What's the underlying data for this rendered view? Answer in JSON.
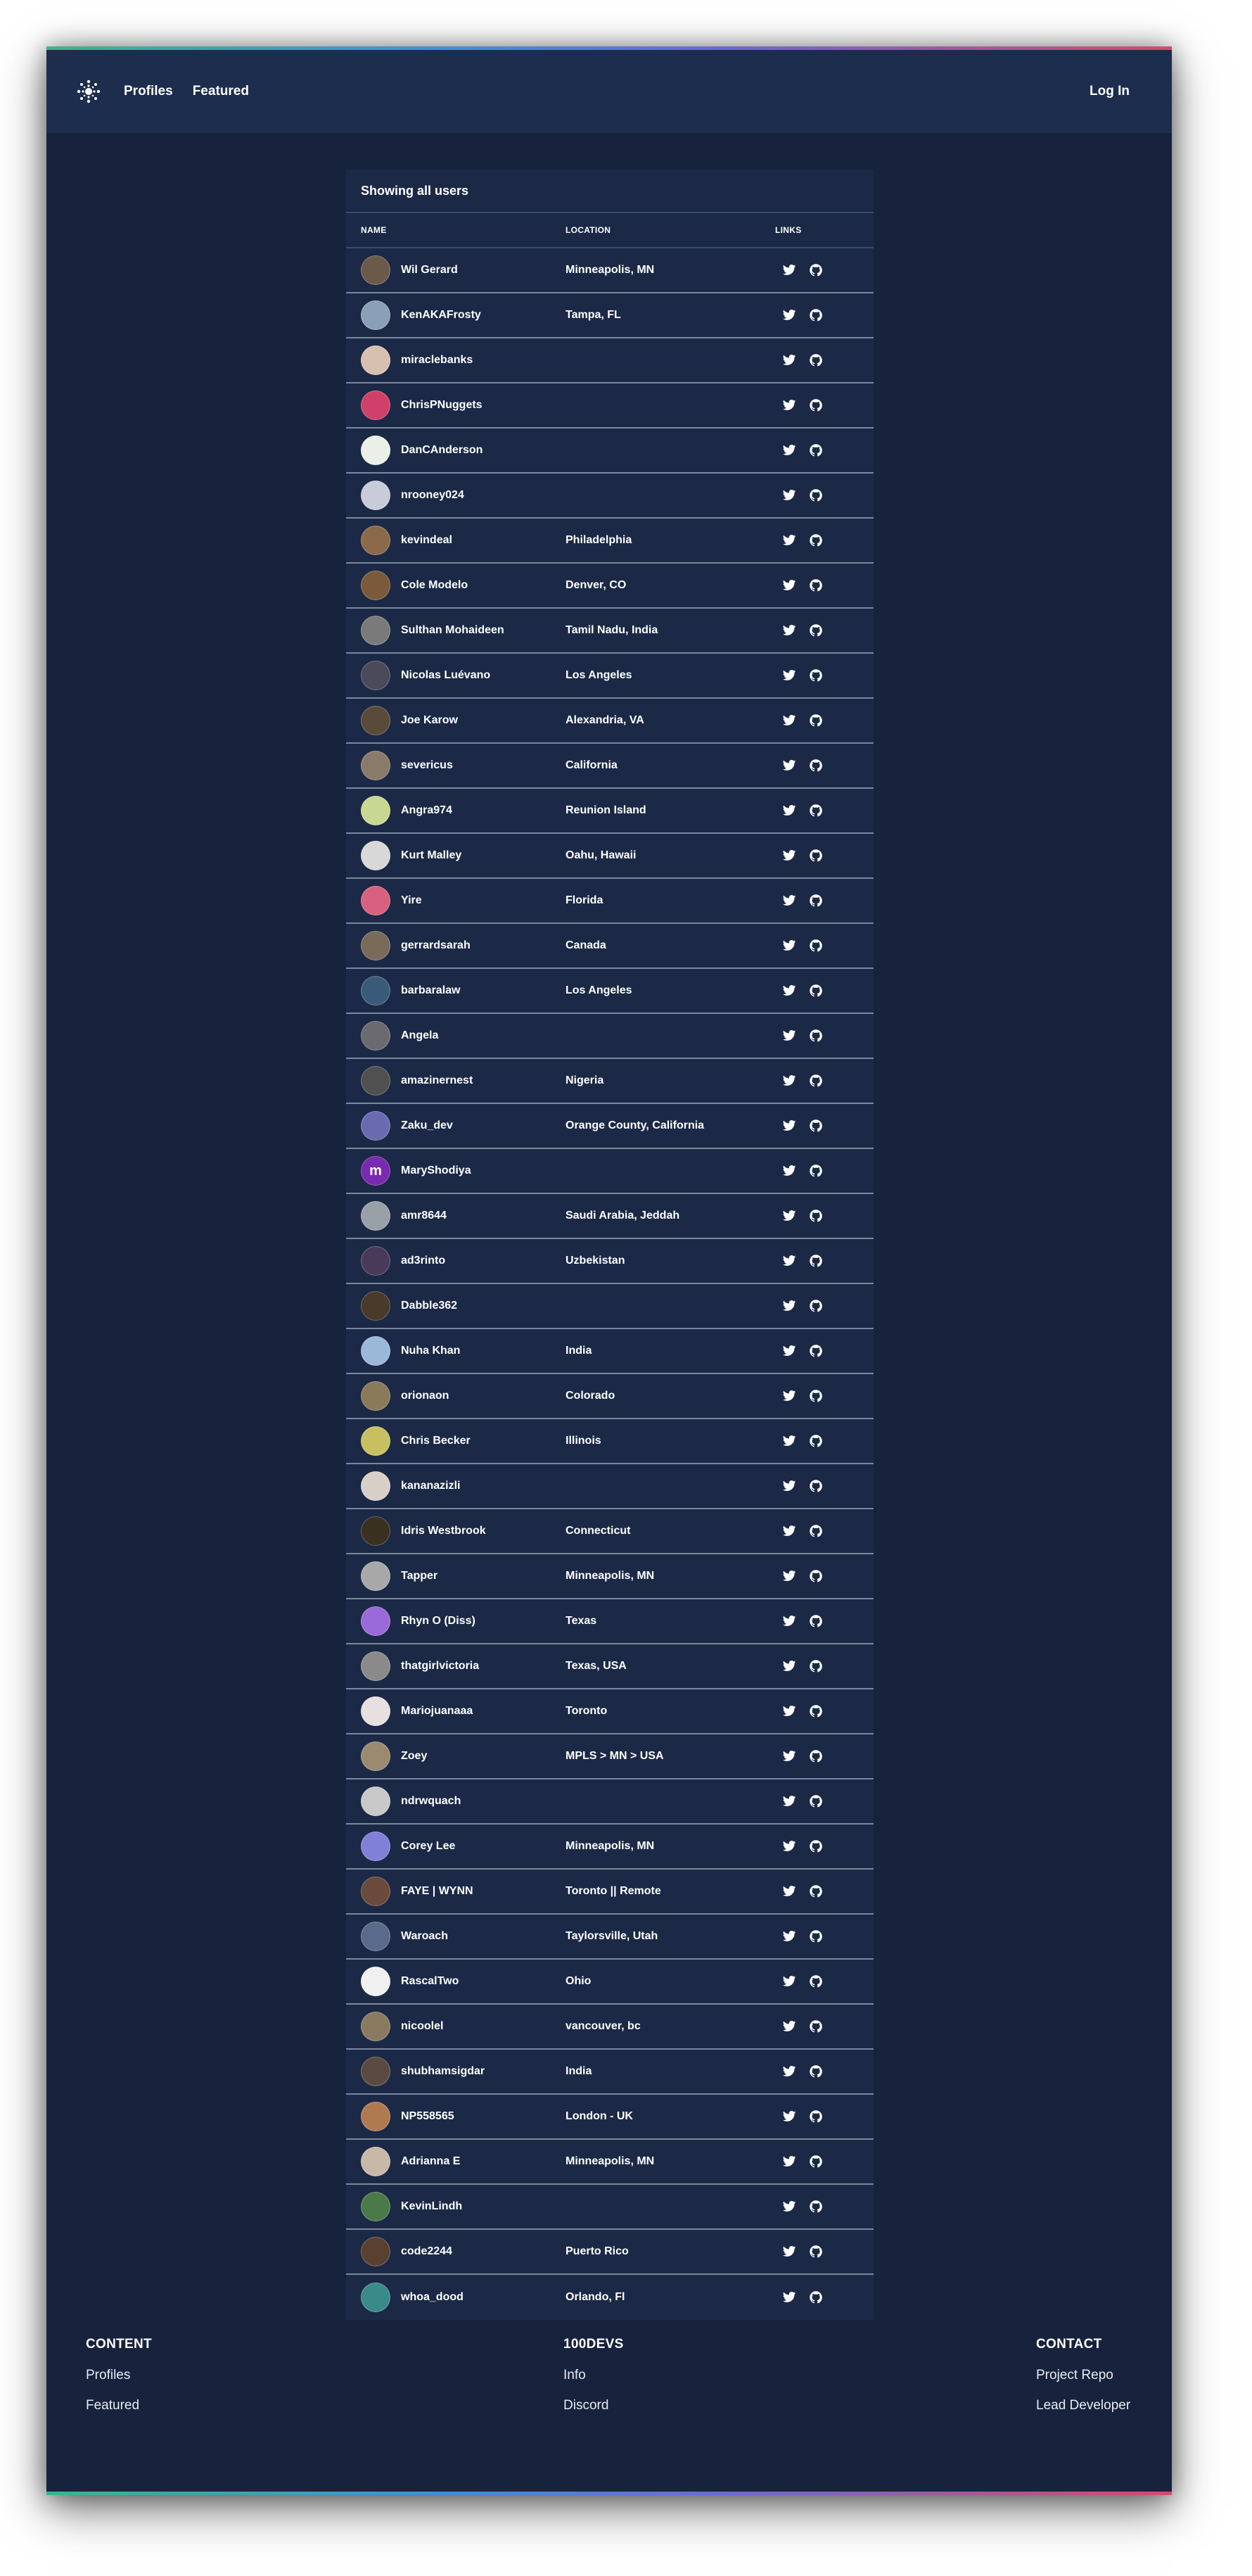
{
  "nav": {
    "logo_icon": "burst-logo-icon",
    "links": [
      "Profiles",
      "Featured"
    ],
    "login": "Log In"
  },
  "table": {
    "title": "Showing all users",
    "headers": {
      "name": "NAME",
      "location": "LOCATION",
      "links": "LINKS"
    },
    "rows": [
      {
        "name": "Wil Gerard",
        "location": "Minneapolis, MN",
        "avatar_color": "#6b5a4a"
      },
      {
        "name": "KenAKAFrosty",
        "location": "Tampa, FL",
        "avatar_color": "#8aa0b8"
      },
      {
        "name": "miraclebanks",
        "location": "",
        "avatar_color": "#d8c0b0"
      },
      {
        "name": "ChrisPNuggets",
        "location": "",
        "avatar_color": "#d0406a"
      },
      {
        "name": "DanCAnderson",
        "location": "",
        "avatar_color": "#e8f0e8"
      },
      {
        "name": "nrooney024",
        "location": "",
        "avatar_color": "#c8ccd8"
      },
      {
        "name": "kevindeal",
        "location": "Philadelphia",
        "avatar_color": "#8a6a4a"
      },
      {
        "name": "Cole Modelo",
        "location": "Denver, CO",
        "avatar_color": "#7a5a3a"
      },
      {
        "name": "Sulthan Mohaideen",
        "location": "Tamil Nadu, India",
        "avatar_color": "#7a7a7a"
      },
      {
        "name": "Nicolas Luévano",
        "location": "Los Angeles",
        "avatar_color": "#4a4a5a"
      },
      {
        "name": "Joe Karow",
        "location": "Alexandria, VA",
        "avatar_color": "#5a4a3a"
      },
      {
        "name": "severicus",
        "location": "California",
        "avatar_color": "#8a7a6a"
      },
      {
        "name": "Angra974",
        "location": "Reunion Island",
        "avatar_color": "#c8d890"
      },
      {
        "name": "Kurt Malley",
        "location": "Oahu, Hawaii",
        "avatar_color": "#d8d8d8"
      },
      {
        "name": "Yire",
        "location": "Florida",
        "avatar_color": "#d86080"
      },
      {
        "name": "gerrardsarah",
        "location": "Canada",
        "avatar_color": "#7a6a5a"
      },
      {
        "name": "barbaralaw",
        "location": "Los Angeles",
        "avatar_color": "#3a5a7a"
      },
      {
        "name": "Angela",
        "location": "",
        "avatar_color": "#6a6a70"
      },
      {
        "name": "amazinernest",
        "location": "Nigeria",
        "avatar_color": "#505050"
      },
      {
        "name": "Zaku_dev",
        "location": "Orange County, California",
        "avatar_color": "#6a6ab0"
      },
      {
        "name": "MaryShodiya",
        "location": "",
        "avatar_color": "#7a2ab0",
        "avatar_letter": "m"
      },
      {
        "name": "amr8644",
        "location": "Saudi Arabia, Jeddah",
        "avatar_color": "#9aa0a8"
      },
      {
        "name": "ad3rinto",
        "location": "Uzbekistan",
        "avatar_color": "#4a3a5a"
      },
      {
        "name": "Dabble362",
        "location": "",
        "avatar_color": "#4a3a2a"
      },
      {
        "name": "Nuha Khan",
        "location": "India",
        "avatar_color": "#9ab8d8"
      },
      {
        "name": "orionaon",
        "location": "Colorado",
        "avatar_color": "#8a7a5a"
      },
      {
        "name": "Chris Becker",
        "location": "Illinois",
        "avatar_color": "#c8c060"
      },
      {
        "name": "kananazizli",
        "location": "",
        "avatar_color": "#d8d0c8"
      },
      {
        "name": "Idris Westbrook",
        "location": "Connecticut",
        "avatar_color": "#3a3020"
      },
      {
        "name": "Tapper",
        "location": "Minneapolis, MN",
        "avatar_color": "#a8a8a8"
      },
      {
        "name": "Rhyn O (Diss)",
        "location": "Texas",
        "avatar_color": "#9a6ad8"
      },
      {
        "name": "thatgirlvictoria",
        "location": "Texas, USA",
        "avatar_color": "#8a8a8a"
      },
      {
        "name": "Mariojuanaaa",
        "location": "Toronto",
        "avatar_color": "#e8e0e0"
      },
      {
        "name": "Zoey",
        "location": "MPLS > MN > USA",
        "avatar_color": "#9a8a70"
      },
      {
        "name": "ndrwquach",
        "location": "",
        "avatar_color": "#c8c8c8"
      },
      {
        "name": "Corey Lee",
        "location": "Minneapolis, MN",
        "avatar_color": "#8080d8"
      },
      {
        "name": "FAYE | WYNN",
        "location": "Toronto || Remote",
        "avatar_color": "#6a4a3a"
      },
      {
        "name": "Waroach",
        "location": "Taylorsville, Utah",
        "avatar_color": "#5a6a8a"
      },
      {
        "name": "RascalTwo",
        "location": "Ohio",
        "avatar_color": "#f0f0f0"
      },
      {
        "name": "nicoolel",
        "location": "vancouver, bc",
        "avatar_color": "#8a7a60"
      },
      {
        "name": "shubhamsigdar",
        "location": "India",
        "avatar_color": "#5a4a40"
      },
      {
        "name": "NP558565",
        "location": "London - UK",
        "avatar_color": "#b07a50"
      },
      {
        "name": "Adrianna E",
        "location": "Minneapolis, MN",
        "avatar_color": "#c8b8a8"
      },
      {
        "name": "KevinLindh",
        "location": "",
        "avatar_color": "#4a7a4a"
      },
      {
        "name": "code2244",
        "location": "Puerto Rico",
        "avatar_color": "#5a4030"
      },
      {
        "name": "whoa_dood",
        "location": "Orlando, Fl",
        "avatar_color": "#3a8a8a"
      }
    ],
    "link_icons": [
      "twitter-icon",
      "github-icon"
    ]
  },
  "footer": {
    "columns": [
      {
        "heading": "CONTENT",
        "links": [
          "Profiles",
          "Featured"
        ]
      },
      {
        "heading": "100DEVS",
        "links": [
          "Info",
          "Discord"
        ]
      },
      {
        "heading": "CONTACT",
        "links": [
          "Project Repo",
          "Lead Developer"
        ]
      }
    ]
  },
  "colors": {
    "background": "#17233c",
    "navbar": "#1d2d4d",
    "card": "#1b2946",
    "row_divider": "#7b879c",
    "gradient": [
      "#3bb58a",
      "#3f8fd8",
      "#6a6ad6",
      "#d64a6a"
    ]
  }
}
